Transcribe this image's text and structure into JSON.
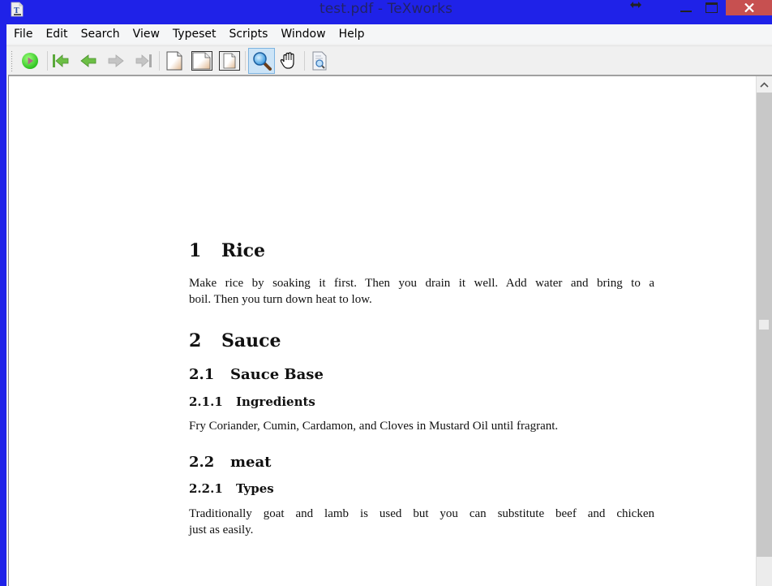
{
  "window": {
    "title": "test.pdf - TeXworks",
    "controls": {
      "minimize": "minimize",
      "maximize": "maximize",
      "close": "close"
    }
  },
  "menubar": {
    "items": [
      "File",
      "Edit",
      "Search",
      "View",
      "Typeset",
      "Scripts",
      "Window",
      "Help"
    ]
  },
  "toolbar": {
    "tools": [
      {
        "name": "typeset",
        "icon": "play-icon"
      },
      {
        "name": "first-page",
        "icon": "first-page-icon"
      },
      {
        "name": "previous-page",
        "icon": "arrow-left-icon"
      },
      {
        "name": "next-page",
        "icon": "arrow-right-icon"
      },
      {
        "name": "last-page",
        "icon": "last-page-icon"
      },
      {
        "name": "actual-size",
        "icon": "page-icon"
      },
      {
        "name": "fit-width",
        "icon": "page-icon"
      },
      {
        "name": "fit-window",
        "icon": "page-icon"
      },
      {
        "name": "magnify",
        "icon": "magnifier-icon",
        "active": true
      },
      {
        "name": "scroll",
        "icon": "hand-icon"
      },
      {
        "name": "find",
        "icon": "document-search-icon"
      }
    ]
  },
  "document": {
    "sections": [
      {
        "num": "1",
        "title": "Rice"
      },
      {
        "num": "2",
        "title": "Sauce"
      }
    ],
    "subsections": [
      {
        "num": "2.1",
        "title": "Sauce Base"
      },
      {
        "num": "2.2",
        "title": "meat"
      }
    ],
    "subsubsections": [
      {
        "num": "2.1.1",
        "title": "Ingredients"
      },
      {
        "num": "2.2.1",
        "title": "Types"
      }
    ],
    "paragraphs": [
      {
        "line1": "Make rice by soaking it first. Then you drain it well. Add water and bring to a",
        "line2": "boil. Then you turn down heat to low."
      },
      {
        "line1": "Fry Coriander, Cumin, Cardamon, and Cloves in Mustard Oil until fragrant."
      },
      {
        "line1": "Traditionally goat and lamb is used but you can substitute beef and chicken",
        "line2": "just as easily."
      }
    ]
  },
  "colors": {
    "titlebar": "#1f22e8",
    "close": "#c75050",
    "active_tool": "#cce4f7"
  }
}
